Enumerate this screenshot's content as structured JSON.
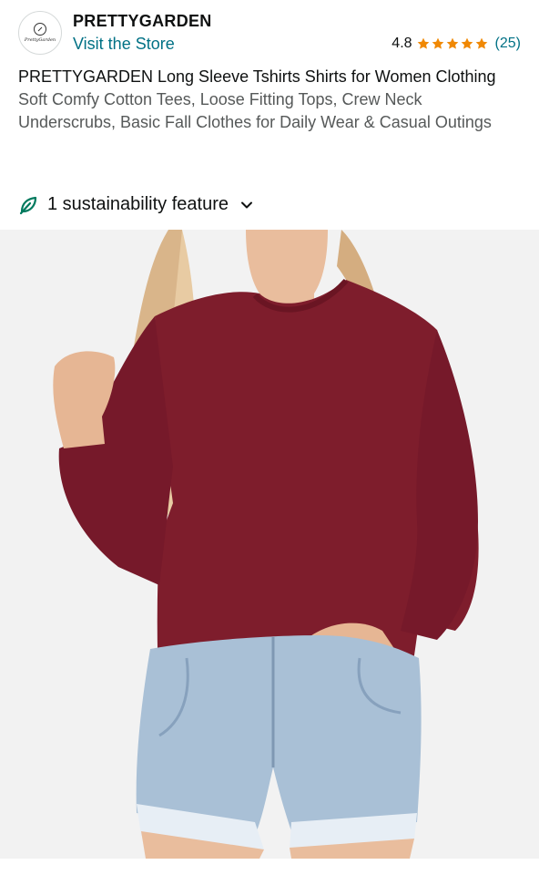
{
  "brand": {
    "name": "PRETTYGARDEN",
    "logo_text": "PrettyGarden",
    "visit_label": "Visit the Store"
  },
  "rating": {
    "value": "4.8",
    "stars": 5,
    "count": "(25)",
    "star_color": "#f08804"
  },
  "product": {
    "title": "PRETTYGARDEN Long Sleeve Tshirts Shirts for Women Clothing",
    "subtitle": "Soft Comfy Cotton Tees, Loose Fitting Tops, Crew Neck Underscrubs, Basic Fall Clothes for Daily Wear & Casual Outings"
  },
  "sustainability": {
    "label": "1 sustainability feature",
    "icon": "leaf-icon",
    "icon_color": "#007a5e"
  },
  "colors": {
    "link": "#007185",
    "shirt": "#7e1d2c",
    "denim": "#a9c0d6"
  }
}
